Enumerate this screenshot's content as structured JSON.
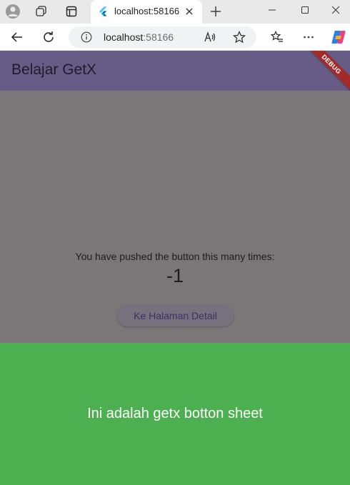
{
  "browser": {
    "tab": {
      "title": "localhost:58166"
    },
    "address_bar": {
      "host": "localhost",
      "port": ":58166"
    }
  },
  "app": {
    "title": "Belajar GetX",
    "debug_banner": "DEBUG",
    "counter_label": "You have pushed the button this many times:",
    "counter_value": "-1",
    "detail_button_label": "Ke Halaman Detail",
    "bottom_sheet_text": "Ini adalah getx botton sheet"
  },
  "colors": {
    "app_bar": "#675c85",
    "scrim_content": "#7b7677",
    "bottom_sheet": "#4caf50",
    "debug_banner": "#a32a2a"
  }
}
